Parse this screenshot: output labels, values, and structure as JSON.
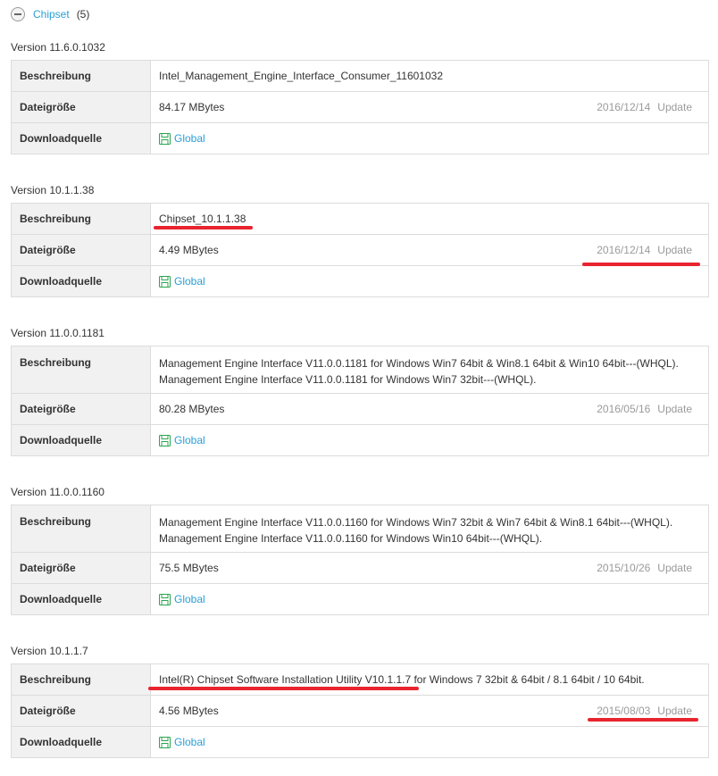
{
  "section": {
    "title": "Chipset",
    "count": "(5)",
    "collapse_icon": "minus-circle-icon"
  },
  "labels": {
    "description": "Beschreibung",
    "filesize": "Dateigröße",
    "source": "Downloadquelle"
  },
  "download_icon": "floppy-disk-icon",
  "accent_color": "#2a9fd6",
  "highlight_color": "#e8242f",
  "versions": [
    {
      "version": "Version 11.6.0.1032",
      "description_lines": [
        "Intel_Management_Engine_Interface_Consumer_11601032"
      ],
      "filesize": "84.17 MBytes",
      "date": "2016/12/14",
      "update": "Update",
      "source": "Global"
    },
    {
      "version": "Version 10.1.1.38",
      "description_lines": [
        "Chipset_10.1.1.38"
      ],
      "filesize": "4.49 MBytes",
      "date": "2016/12/14",
      "update": "Update",
      "source": "Global"
    },
    {
      "version": "Version 11.0.0.1181",
      "description_lines": [
        "Management Engine Interface V11.0.0.1181 for Windows Win7 64bit & Win8.1 64bit & Win10 64bit---(WHQL).",
        "Management Engine Interface V11.0.0.1181 for Windows Win7 32bit---(WHQL)."
      ],
      "filesize": "80.28 MBytes",
      "date": "2016/05/16",
      "update": "Update",
      "source": "Global"
    },
    {
      "version": "Version 11.0.0.1160",
      "description_lines": [
        "Management Engine Interface V11.0.0.1160 for Windows Win7 32bit & Win7 64bit & Win8.1 64bit---(WHQL).",
        "Management Engine Interface V11.0.0.1160 for Windows Win10 64bit---(WHQL)."
      ],
      "filesize": "75.5 MBytes",
      "date": "2015/10/26",
      "update": "Update",
      "source": "Global"
    },
    {
      "version": "Version 10.1.1.7",
      "description_lines": [
        "Intel(R) Chipset Software Installation Utility V10.1.1.7 for Windows 7 32bit & 64bit / 8.1 64bit / 10 64bit."
      ],
      "filesize": "4.56 MBytes",
      "date": "2015/08/03",
      "update": "Update",
      "source": "Global"
    }
  ]
}
